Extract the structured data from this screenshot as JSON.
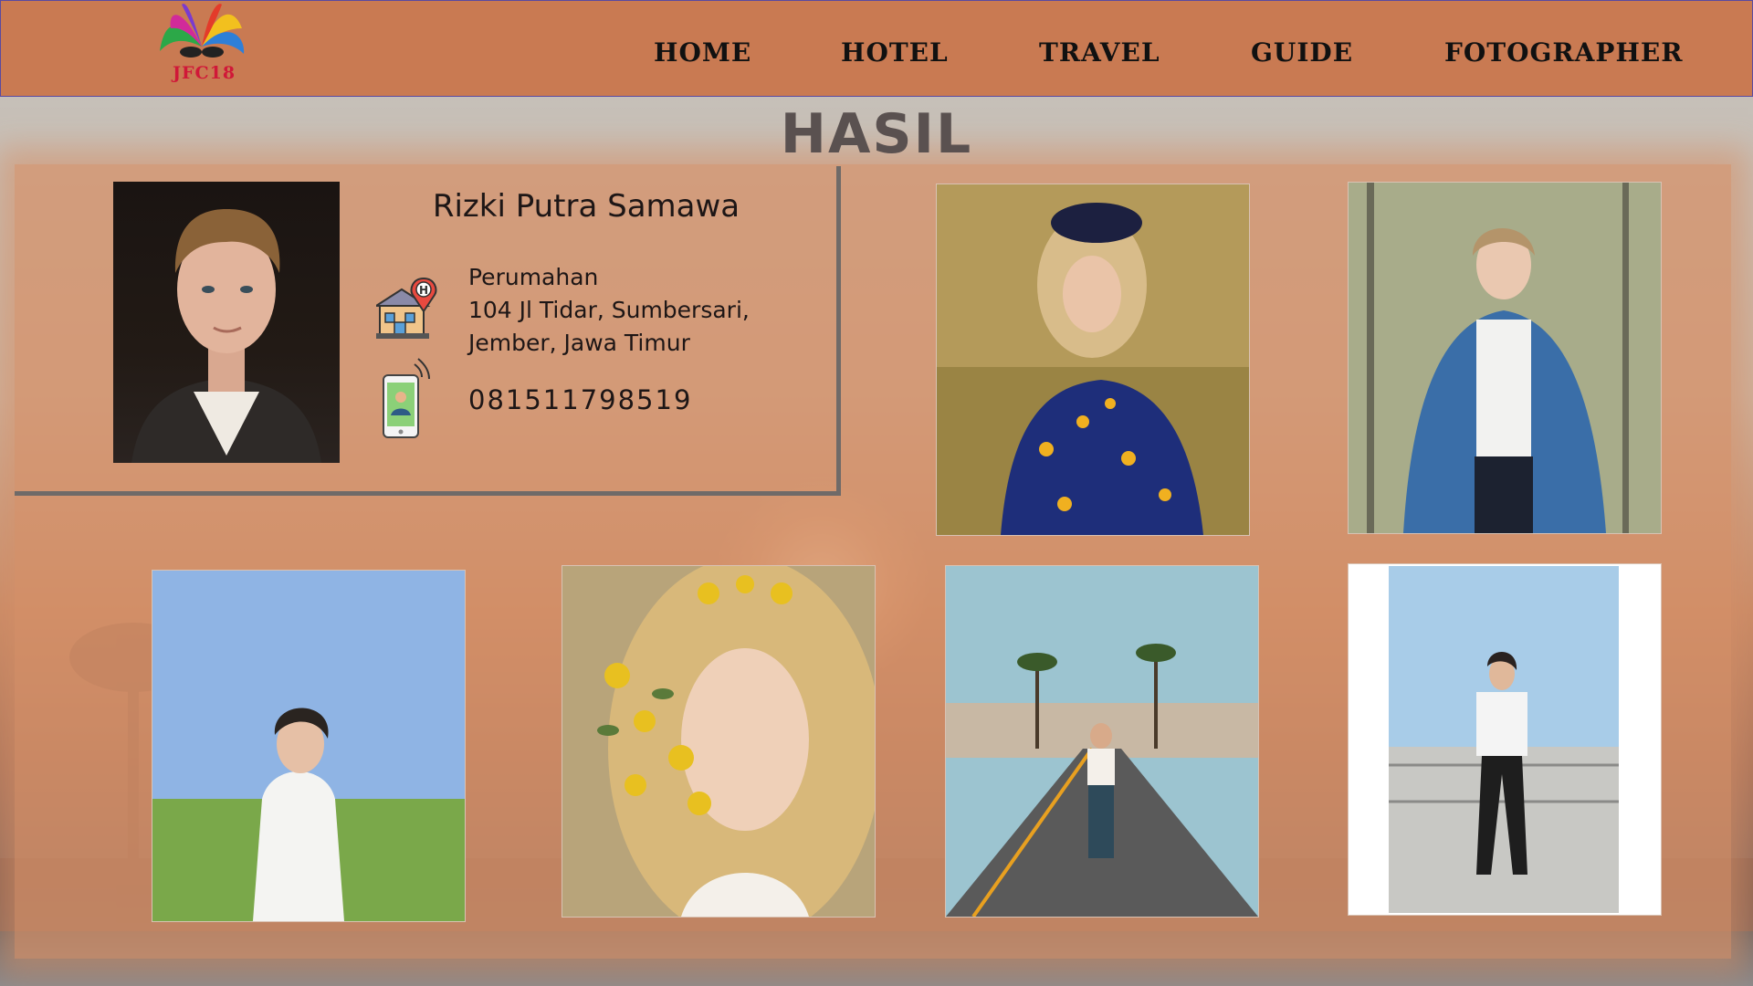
{
  "logo": {
    "text": "JFC",
    "number": "18"
  },
  "nav": {
    "items": [
      {
        "label": "HOME"
      },
      {
        "label": "HOTEL"
      },
      {
        "label": "TRAVEL"
      },
      {
        "label": "GUIDE"
      },
      {
        "label": "FOTOGRAPHER"
      }
    ]
  },
  "page_title": "HASIL",
  "profile": {
    "name": "Rizki Putra Samawa",
    "address_lines": [
      "Perumahan",
      "104 Jl Tidar, Sumbersari,",
      "Jember, Jawa Timur"
    ],
    "phone": "081511798519",
    "icons": {
      "address": "hotel-location-icon",
      "phone": "smartphone-contact-icon"
    }
  },
  "gallery": [
    {
      "subject": "woman-in-floral-dress-in-grass"
    },
    {
      "subject": "man-in-denim-shirt-among-trees"
    },
    {
      "subject": "young-man-in-field-under-sky"
    },
    {
      "subject": "blonde-woman-with-yellow-flowers"
    },
    {
      "subject": "woman-walking-on-palm-street"
    },
    {
      "subject": "woman-on-sunny-rooftop"
    }
  ],
  "colors": {
    "nav_bg": "#c97a52",
    "panel_bg": "#d69068",
    "title": "#5a5150",
    "text": "#1d1616"
  }
}
